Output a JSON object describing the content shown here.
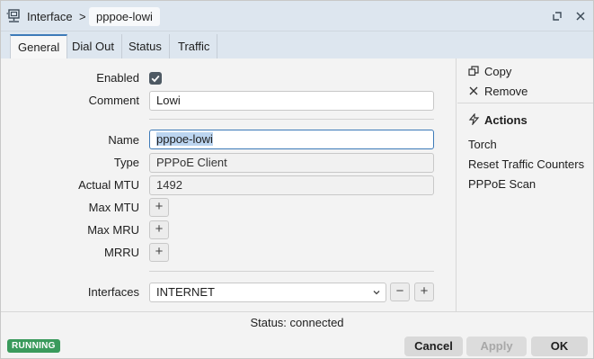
{
  "titlebar": {
    "crumb": "Interface",
    "separator": ">",
    "current": "pppoe-lowi",
    "restore_icon": "restore-icon",
    "close_icon": "close-icon"
  },
  "tabs": [
    {
      "label": "General",
      "active": true
    },
    {
      "label": "Dial Out",
      "active": false
    },
    {
      "label": "Status",
      "active": false
    },
    {
      "label": "Traffic",
      "active": false
    }
  ],
  "form": {
    "enabled": {
      "label": "Enabled",
      "checked": true
    },
    "comment": {
      "label": "Comment",
      "value": "Lowi"
    },
    "name": {
      "label": "Name",
      "value": "pppoe-lowi"
    },
    "type": {
      "label": "Type",
      "value": "PPPoE Client"
    },
    "actual_mtu": {
      "label": "Actual MTU",
      "value": "1492"
    },
    "max_mtu": {
      "label": "Max MTU"
    },
    "max_mru": {
      "label": "Max MRU"
    },
    "mrru": {
      "label": "MRRU"
    },
    "interfaces": {
      "label": "Interfaces",
      "value": "INTERNET"
    },
    "plus_symbol": "+",
    "minus_symbol": "−"
  },
  "side": {
    "copy": "Copy",
    "remove": "Remove",
    "actions_title": "Actions",
    "torch": "Torch",
    "reset_traffic": "Reset Traffic Counters",
    "pppoe_scan": "PPPoE Scan"
  },
  "status": {
    "text": "Status: connected",
    "badge": "RUNNING",
    "badge_color": "#3a9a5c"
  },
  "buttons": {
    "cancel": "Cancel",
    "apply": "Apply",
    "ok": "OK"
  }
}
